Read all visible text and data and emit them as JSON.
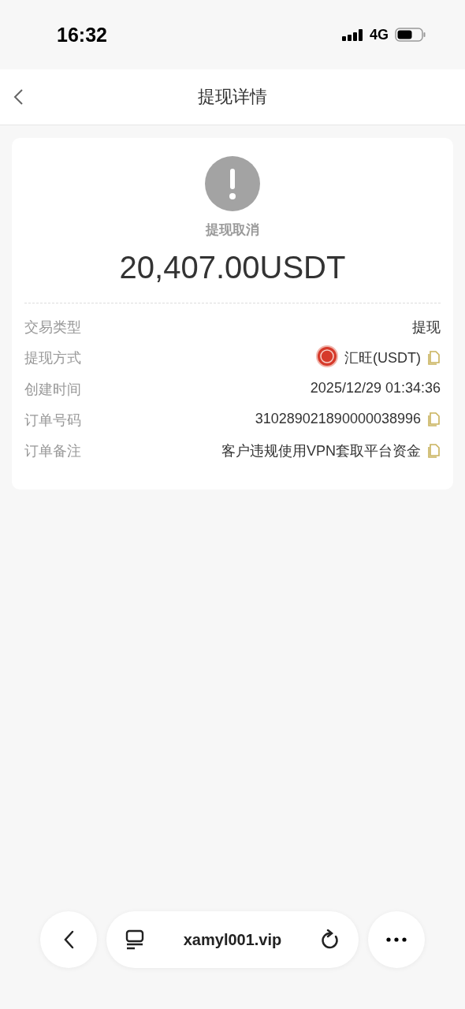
{
  "status_bar": {
    "time": "16:32",
    "network": "4G"
  },
  "nav": {
    "title": "提现详情"
  },
  "summary": {
    "status": "提现取消",
    "amount": "20,407.00USDT"
  },
  "rows": [
    {
      "kind": "text",
      "label": "交易类型",
      "value": "提现",
      "copyable": false
    },
    {
      "kind": "method",
      "label": "提现方式",
      "value": "汇旺(USDT)",
      "copyable": true
    },
    {
      "kind": "text",
      "label": "创建时间",
      "value": "2025/12/29 01:34:36",
      "copyable": false
    },
    {
      "kind": "text",
      "label": "订单号码",
      "value": "310289021890000038996",
      "copyable": true
    },
    {
      "kind": "text",
      "label": "订单备注",
      "value": "客户违规使用VPN套取平台资金",
      "copyable": true
    }
  ],
  "browser_bar": {
    "url": "xamyl001.vip"
  }
}
